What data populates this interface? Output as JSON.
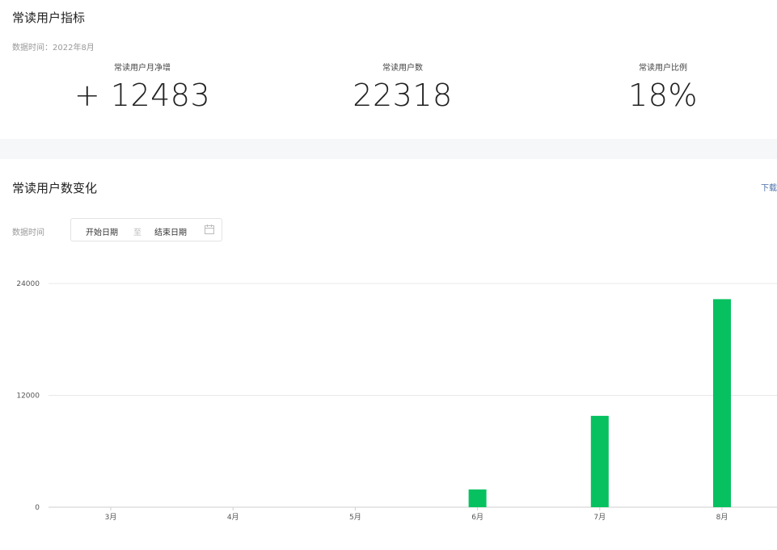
{
  "metrics_section": {
    "title": "常读用户指标",
    "data_time": "数据时间：2022年8月",
    "items": [
      {
        "label": "常读用户月净增",
        "value": "+ 12483"
      },
      {
        "label": "常读用户数",
        "value": "22318"
      },
      {
        "label": "常读用户比例",
        "value": "18%"
      }
    ]
  },
  "trend_section": {
    "title": "常读用户数变化",
    "download_label": "下载",
    "range_label": "数据时间",
    "start_placeholder": "开始日期",
    "separator": "至",
    "end_placeholder": "结束日期",
    "calendar_icon": "calendar-icon"
  },
  "colors": {
    "bar": "#07c160",
    "link": "#4b6ea8",
    "grid": "#e8e8e8"
  },
  "chart_data": {
    "type": "bar",
    "categories": [
      "3月",
      "4月",
      "5月",
      "6月",
      "7月",
      "8月"
    ],
    "values": [
      0,
      0,
      0,
      1900,
      9800,
      22318
    ],
    "yticks": [
      0,
      12000,
      24000
    ],
    "ylim": [
      0,
      24000
    ],
    "title": "",
    "xlabel": "",
    "ylabel": ""
  }
}
